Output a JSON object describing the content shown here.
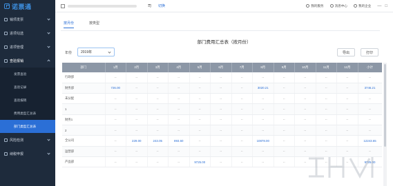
{
  "app": {
    "logo_text": "诺票通"
  },
  "sidebar": {
    "items": [
      {
        "label": "销项发票",
        "open": false
      },
      {
        "label": "进项勾选",
        "open": false
      },
      {
        "label": "进项管理",
        "open": false
      },
      {
        "label": "查验报销",
        "open": true
      },
      {
        "label": "风险检测",
        "open": false
      },
      {
        "label": "纳税申报",
        "open": false
      }
    ],
    "sub_items": [
      {
        "label": "发票查验"
      },
      {
        "label": "查验记录"
      },
      {
        "label": "查验报销"
      },
      {
        "label": "费用类型汇总表"
      },
      {
        "label": "部门类型汇总表",
        "active": true
      }
    ]
  },
  "topbar": {
    "company_suffix": "司",
    "switch_label": "切换",
    "my_service": "我的服务",
    "message_center": "消息中心",
    "my_company": "我的企业",
    "window_controls": [
      "—",
      "□"
    ]
  },
  "tabs": [
    {
      "label": "按月份",
      "active": true
    },
    {
      "label": "按类型",
      "active": false
    }
  ],
  "report": {
    "title": "部门费用汇总表（按月份）",
    "year_label": "年份",
    "year_value": "2019年",
    "export_label": "导出",
    "print_label": "打印"
  },
  "table": {
    "headers": [
      "部门",
      "1月",
      "2月",
      "3月",
      "4月",
      "5月",
      "6月",
      "7月",
      "8月",
      "9月",
      "10月",
      "11月",
      "12月",
      "小计"
    ],
    "rows": [
      [
        "行政部",
        "--",
        "--",
        "--",
        "--",
        "--",
        "--",
        "--",
        "--",
        "--",
        "--",
        "--",
        "--",
        "--"
      ],
      [
        "财务部",
        "726.00",
        "--",
        "--",
        "--",
        "--",
        "--",
        "--",
        "3020.21",
        "--",
        "--",
        "--",
        "--",
        "3746.21"
      ],
      [
        "未分配",
        "--",
        "--",
        "--",
        "--",
        "--",
        "--",
        "--",
        "--",
        "--",
        "--",
        "--",
        "--",
        "--"
      ],
      [
        "1",
        "--",
        "--",
        "--",
        "--",
        "--",
        "--",
        "--",
        "--",
        "--",
        "--",
        "--",
        "--",
        "--"
      ],
      [
        "财务1",
        "--",
        "--",
        "--",
        "--",
        "--",
        "--",
        "--",
        "--",
        "--",
        "--",
        "--",
        "--",
        "--"
      ],
      [
        "2",
        "--",
        "--",
        "--",
        "--",
        "--",
        "--",
        "--",
        "--",
        "--",
        "--",
        "--",
        "--",
        "--"
      ],
      [
        "全公司",
        "--",
        "229.00",
        "243.05",
        "893.60",
        "--",
        "--",
        "--",
        "10878.00",
        "--",
        "--",
        "--",
        "--",
        "12243.65"
      ],
      [
        "运营部",
        "--",
        "--",
        "--",
        "--",
        "--",
        "--",
        "--",
        "--",
        "--",
        "--",
        "--",
        "--",
        "--"
      ],
      [
        "产品部",
        "--",
        "--",
        "--",
        "--",
        "9725.00",
        "--",
        "--",
        "--",
        "--",
        "--",
        "--",
        "--",
        "9725.00"
      ]
    ]
  },
  "colors": {
    "sidebar_bg": "#1e2b3c",
    "accent": "#2b6fd6",
    "table_header_bg": "#8c97a6"
  }
}
